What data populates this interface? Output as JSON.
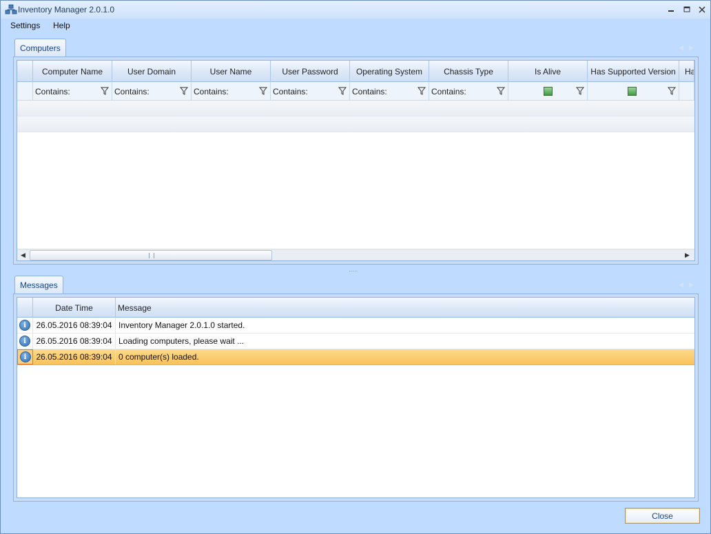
{
  "window": {
    "title": "Inventory Manager 2.0.1.0"
  },
  "menu": {
    "items": [
      "Settings",
      "Help"
    ]
  },
  "computers": {
    "tab_label": "Computers",
    "columns": [
      "Computer Name",
      "User Domain",
      "User Name",
      "User Password",
      "Operating System",
      "Chassis Type",
      "Is Alive",
      "Has Supported Version",
      "Ha"
    ],
    "filter_text": "Contains:",
    "rows": []
  },
  "messages": {
    "tab_label": "Messages",
    "columns": [
      "Date Time",
      "Message"
    ],
    "rows": [
      {
        "icon": "info-icon",
        "datetime": "26.05.2016 08:39:04",
        "message": "Inventory Manager 2.0.1.0 started."
      },
      {
        "icon": "info-icon",
        "datetime": "26.05.2016 08:39:04",
        "message": "Loading computers, please wait ..."
      },
      {
        "icon": "info-icon",
        "datetime": "26.05.2016 08:39:04",
        "message": "0 computer(s) loaded.",
        "selected": true
      }
    ]
  },
  "footer": {
    "close_label": "Close"
  },
  "colors": {
    "selection": "#f9c25b",
    "accent": "#15428b",
    "frame": "#bfdbff"
  }
}
